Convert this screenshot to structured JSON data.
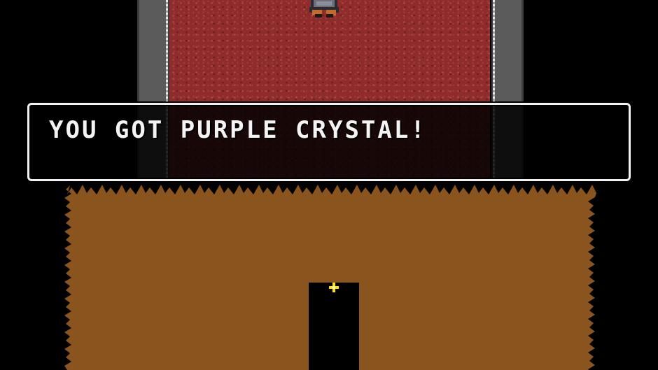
{
  "game": {
    "dialog": {
      "message": "YOU GOT PURPLE CRYSTAL!"
    }
  },
  "colors": {
    "carpet": "#8e2c2c",
    "wall": "#5b5b5b",
    "dirt": "#8a541e",
    "dialog_border": "#f2f2f2",
    "dialog_text": "#f4f4f4",
    "sparkle": "#ffe200"
  },
  "icons": {
    "sparkle": "sparkle-icon",
    "player": "player-sprite"
  }
}
